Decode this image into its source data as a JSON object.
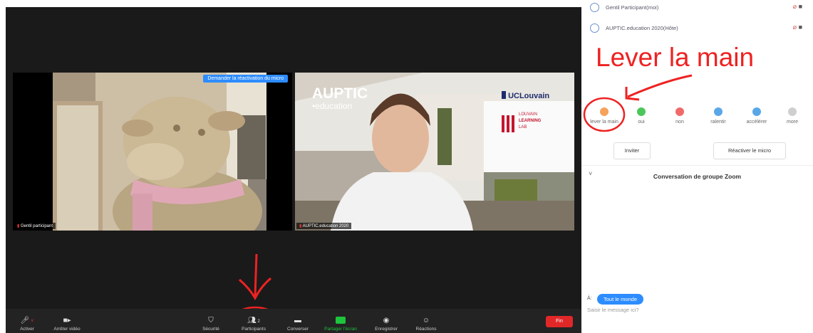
{
  "participants": [
    {
      "name": "Gentil Participant(moi)"
    },
    {
      "name": "AUPTIC.education 2020(Hôte)"
    }
  ],
  "annotation": {
    "text": "Lever la main",
    "color": "#ee2222"
  },
  "video": {
    "request_button": "Demander la réactivation du micro",
    "tile1_name": "Gentil participant",
    "tile2_name": "AUPTIC.education 2020",
    "bg_title": "AUPTIC",
    "bg_sub": "•education",
    "uclouvain": "UCLouvain",
    "lll_1": "LOUVAIN",
    "lll_2": "LEARNING",
    "lll_3": "LAB"
  },
  "toolbar": {
    "items": [
      {
        "label": "Activer",
        "icon": "mic-muted-icon"
      },
      {
        "label": "Arrêter vidéo",
        "icon": "camera-icon"
      },
      {
        "label": "Sécurité",
        "icon": "shield-icon"
      },
      {
        "label": "Participants",
        "icon": "participants-icon"
      },
      {
        "label": "Converser",
        "icon": "chat-icon"
      },
      {
        "label": "Partager l'écran",
        "icon": "share-screen-icon"
      },
      {
        "label": "Enregistrer",
        "icon": "record-icon"
      },
      {
        "label": "Réactions",
        "icon": "reaction-icon"
      }
    ],
    "end": "Fin",
    "share_color": "#1ec43c",
    "end_color": "#e02828"
  },
  "reactions": [
    {
      "label": "lever la main",
      "color": "#f5a25c"
    },
    {
      "label": "oui",
      "color": "#4cc65a"
    },
    {
      "label": "non",
      "color": "#f06a6a"
    },
    {
      "label": "ralentir",
      "color": "#5aa7e8"
    },
    {
      "label": "accélérer",
      "color": "#5aa7e8"
    },
    {
      "label": "more",
      "color": "#cfcfcf"
    }
  ],
  "panel_buttons": {
    "invite": "Inviter",
    "unmute": "Réactiver le micro"
  },
  "chat": {
    "title": "Conversation de groupe Zoom",
    "to_label": "À:",
    "to_value": "Tout le monde",
    "placeholder": "Saisir le message ici?"
  },
  "colors": {
    "accent": "#2d8cff",
    "toolbar_bg": "#232323"
  }
}
